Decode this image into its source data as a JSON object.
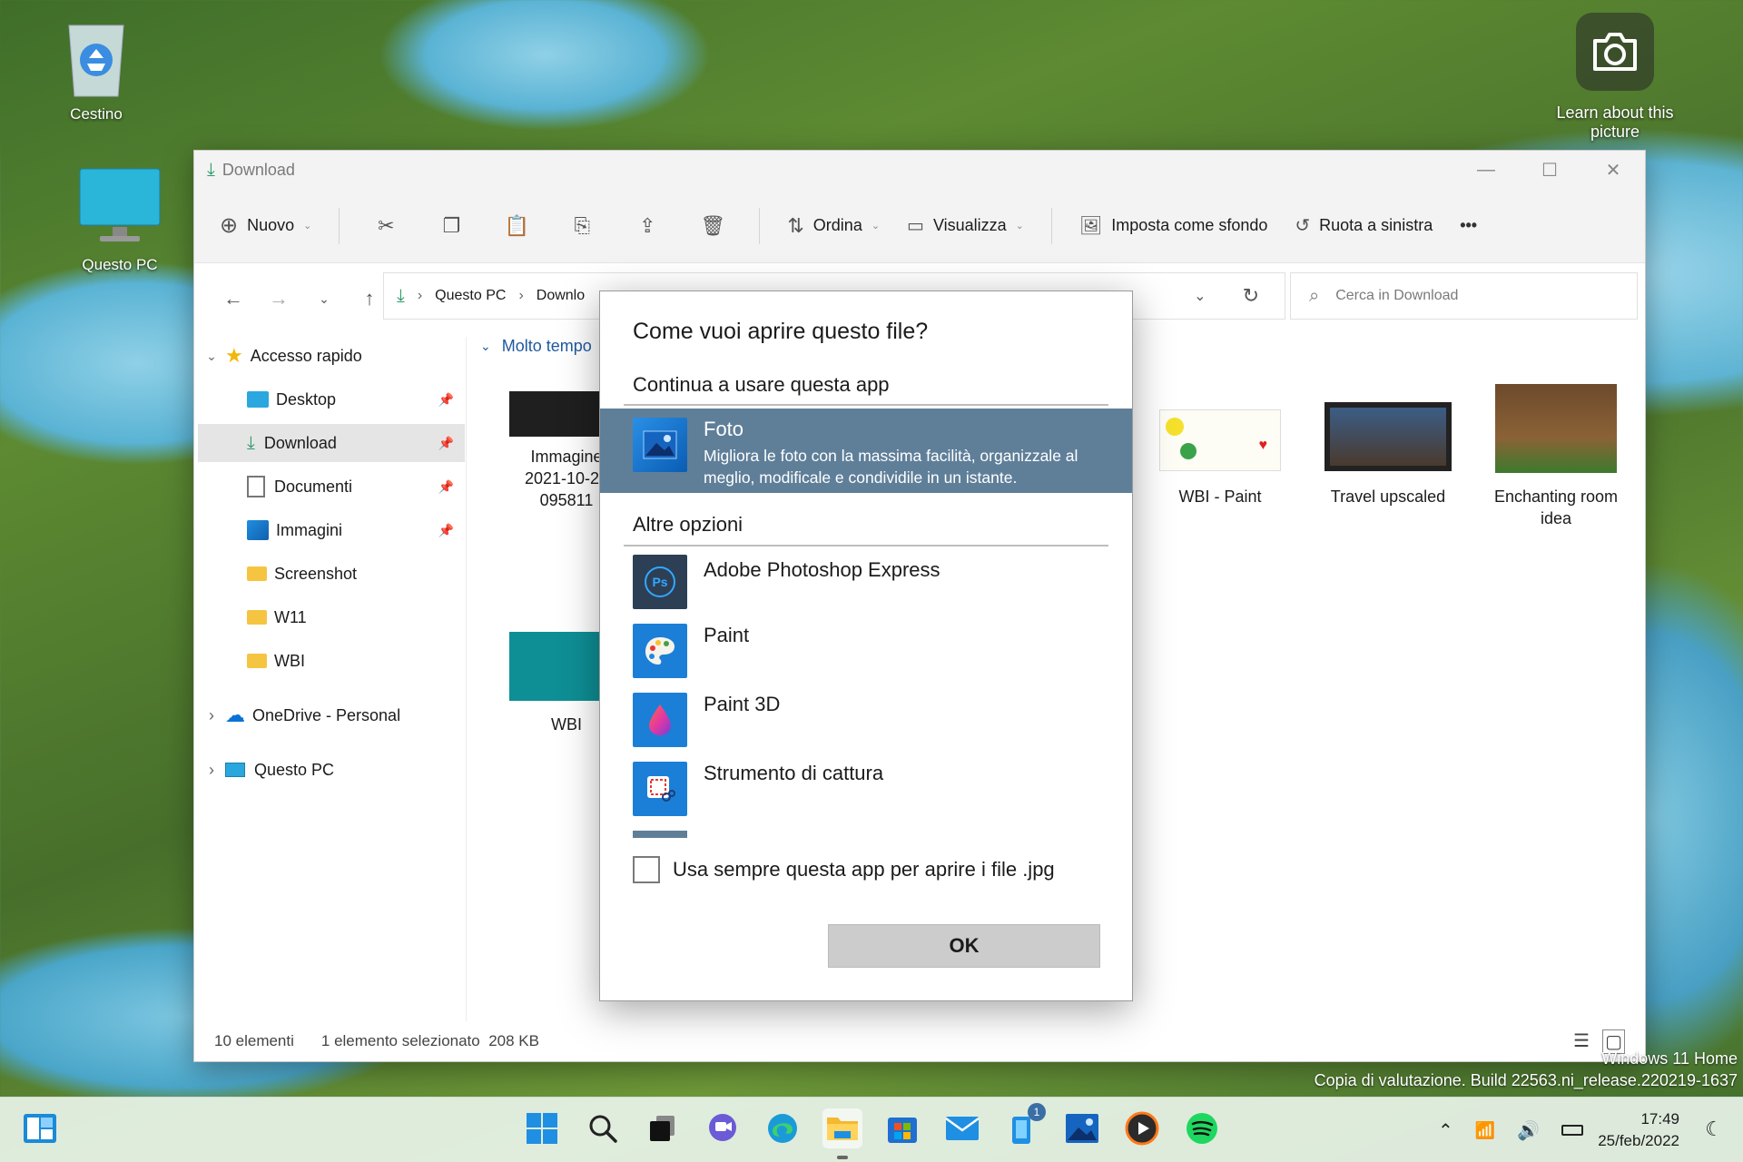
{
  "desktop": {
    "icons": [
      {
        "label": "Cestino",
        "icon": "recycle-bin-icon"
      },
      {
        "label": "Questo PC",
        "icon": "monitor-icon"
      }
    ],
    "lens_label": "Learn about this picture",
    "watermark_line1": "Windows 11 Home",
    "watermark_line2": "Copia di valutazione. Build 22563.ni_release.220219-1637"
  },
  "explorer": {
    "title": "Download",
    "toolbar": {
      "new_label": "Nuovo",
      "sort_label": "Ordina",
      "view_label": "Visualizza",
      "set_background_label": "Imposta come sfondo",
      "rotate_left_label": "Ruota a sinistra",
      "more_label": "•••"
    },
    "address": {
      "crumb_1": "Questo PC",
      "crumb_2": "Downlo"
    },
    "search_placeholder": "Cerca in Download",
    "sidebar": {
      "quick_access": "Accesso rapido",
      "items": [
        {
          "label": "Desktop"
        },
        {
          "label": "Download"
        },
        {
          "label": "Documenti"
        },
        {
          "label": "Immagini"
        },
        {
          "label": "Screenshot"
        },
        {
          "label": "W11"
        },
        {
          "label": "WBI"
        }
      ],
      "onedrive": "OneDrive - Personal",
      "this_pc": "Questo PC"
    },
    "content": {
      "group_header": "Molto tempo",
      "files": [
        {
          "label_1": "Immagine",
          "label_2": "2021-10-29",
          "label_3": "095811"
        },
        {
          "label_1": "WBI - Paint"
        },
        {
          "label_1": "Travel upscaled"
        },
        {
          "label_1": "Enchanting room",
          "label_2": "idea"
        },
        {
          "label_1": "WBI"
        }
      ]
    },
    "status": {
      "count": "10 elementi",
      "selected": "1 elemento selezionato",
      "size": "208 KB"
    }
  },
  "dialog": {
    "title": "Come vuoi aprire questo file?",
    "keep_using": "Continua a usare questa app",
    "selected_app": {
      "name": "Foto",
      "desc_1": "Migliora le foto con la massima facilità, organizzale al",
      "desc_2": "meglio, modificale e condividile in un istante."
    },
    "other_options": "Altre opzioni",
    "apps": [
      {
        "name": "Adobe Photoshop Express",
        "icon": "photoshop-express-icon"
      },
      {
        "name": "Paint",
        "icon": "paint-icon"
      },
      {
        "name": "Paint 3D",
        "icon": "paint-3d-icon"
      },
      {
        "name": "Strumento di cattura",
        "icon": "snipping-tool-icon"
      }
    ],
    "always_use_label": "Usa sempre questa app per aprire i file .jpg",
    "ok_label": "OK"
  },
  "taskbar": {
    "notification_badge": "1",
    "time": "17:49",
    "date": "25/feb/2022"
  },
  "colors": {
    "dialog_selection": "#5f7f99",
    "accent": "#0067c0"
  }
}
